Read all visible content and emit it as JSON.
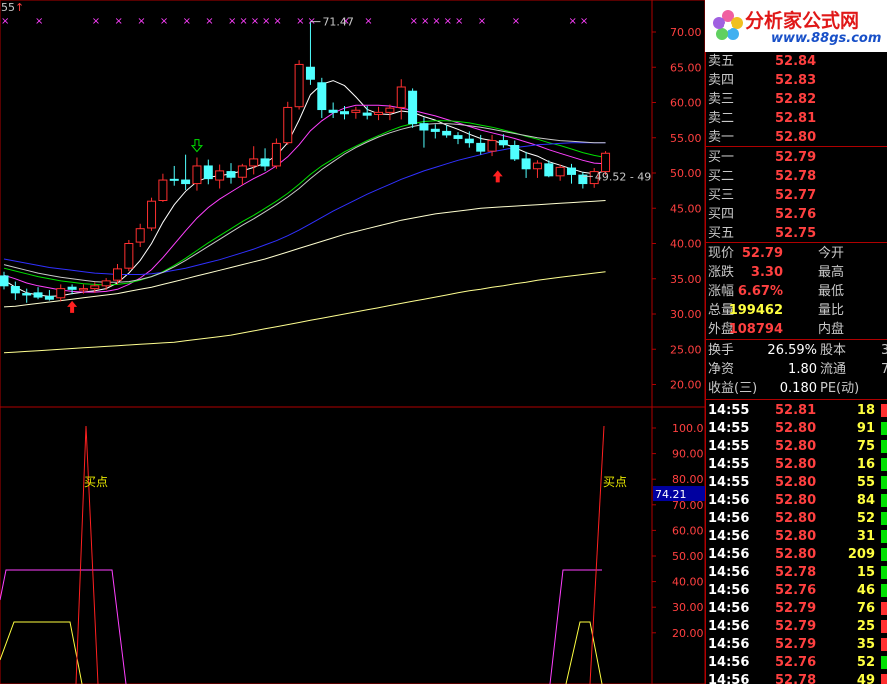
{
  "colors": {
    "background": "#000000",
    "frame": "#b00000",
    "up_candle": "#ff3030",
    "down_candle": "#50ffff",
    "ma_white": "#ffffff",
    "ma_yellow": "#ffff40",
    "ma_magenta": "#ff40ff",
    "ma_green": "#00e000",
    "ma_blue": "#3030ff",
    "ma_light_yellow": "#ffff90",
    "price_red": "#ff4040",
    "volume_yellow": "#ffff40",
    "label_gray": "#c8c8c8"
  },
  "logo": {
    "title": "分析家公式网",
    "url": "www.88gs.com",
    "icon": "flower-logo-icon"
  },
  "top_left_label": "55",
  "main_chart": {
    "y_ticks": [
      "70.00",
      "65.00",
      "60.00",
      "55.00",
      "50.00",
      "45.00",
      "40.00",
      "35.00",
      "30.00",
      "25.00",
      "20.00"
    ],
    "high_label": "71.47",
    "current_label": "49.52 - 49",
    "candles": [
      {
        "o": 35.4,
        "h": 36.0,
        "l": 33.5,
        "c": 34.0
      },
      {
        "o": 33.9,
        "h": 34.6,
        "l": 32.0,
        "c": 33.0
      },
      {
        "o": 32.9,
        "h": 33.6,
        "l": 31.6,
        "c": 32.7
      },
      {
        "o": 33.0,
        "h": 33.8,
        "l": 32.1,
        "c": 32.4
      },
      {
        "o": 32.5,
        "h": 33.4,
        "l": 31.9,
        "c": 32.1
      },
      {
        "o": 32.3,
        "h": 34.2,
        "l": 31.8,
        "c": 33.6
      },
      {
        "o": 33.8,
        "h": 34.2,
        "l": 32.8,
        "c": 33.5
      },
      {
        "o": 33.4,
        "h": 34.2,
        "l": 32.9,
        "c": 33.6
      },
      {
        "o": 33.6,
        "h": 34.5,
        "l": 33.0,
        "c": 34.0
      },
      {
        "o": 34.0,
        "h": 35.1,
        "l": 33.4,
        "c": 34.7
      },
      {
        "o": 34.8,
        "h": 37.1,
        "l": 34.2,
        "c": 36.4
      },
      {
        "o": 36.5,
        "h": 40.5,
        "l": 36.1,
        "c": 40.0
      },
      {
        "o": 40.2,
        "h": 42.8,
        "l": 39.5,
        "c": 42.1
      },
      {
        "o": 42.2,
        "h": 46.5,
        "l": 41.8,
        "c": 46.0
      },
      {
        "o": 46.1,
        "h": 49.9,
        "l": 45.9,
        "c": 49.0
      },
      {
        "o": 49.1,
        "h": 51.0,
        "l": 48.2,
        "c": 49.0
      },
      {
        "o": 49.0,
        "h": 52.6,
        "l": 47.6,
        "c": 48.5
      },
      {
        "o": 48.5,
        "h": 52.2,
        "l": 47.5,
        "c": 51.0
      },
      {
        "o": 51.0,
        "h": 51.9,
        "l": 48.4,
        "c": 49.2
      },
      {
        "o": 49.0,
        "h": 51.2,
        "l": 47.8,
        "c": 50.3
      },
      {
        "o": 50.2,
        "h": 51.4,
        "l": 48.5,
        "c": 49.4
      },
      {
        "o": 49.4,
        "h": 51.3,
        "l": 48.3,
        "c": 51.0
      },
      {
        "o": 51.0,
        "h": 53.8,
        "l": 49.8,
        "c": 52.0
      },
      {
        "o": 52.0,
        "h": 53.5,
        "l": 50.3,
        "c": 51.0
      },
      {
        "o": 51.0,
        "h": 54.9,
        "l": 50.6,
        "c": 54.2
      },
      {
        "o": 54.3,
        "h": 60.1,
        "l": 54.0,
        "c": 59.3
      },
      {
        "o": 59.4,
        "h": 66.0,
        "l": 59.0,
        "c": 65.4
      },
      {
        "o": 65.0,
        "h": 71.5,
        "l": 62.5,
        "c": 63.3
      },
      {
        "o": 62.8,
        "h": 63.5,
        "l": 57.8,
        "c": 59.0
      },
      {
        "o": 58.9,
        "h": 60.0,
        "l": 57.8,
        "c": 58.6
      },
      {
        "o": 58.7,
        "h": 59.5,
        "l": 57.6,
        "c": 58.4
      },
      {
        "o": 58.6,
        "h": 59.4,
        "l": 57.7,
        "c": 58.9
      },
      {
        "o": 58.5,
        "h": 59.5,
        "l": 57.6,
        "c": 58.2
      },
      {
        "o": 58.3,
        "h": 59.4,
        "l": 57.5,
        "c": 58.6
      },
      {
        "o": 58.6,
        "h": 59.7,
        "l": 57.5,
        "c": 59.2
      },
      {
        "o": 59.3,
        "h": 63.3,
        "l": 57.6,
        "c": 62.2
      },
      {
        "o": 61.6,
        "h": 62.0,
        "l": 56.4,
        "c": 57.0
      },
      {
        "o": 57.0,
        "h": 57.9,
        "l": 53.6,
        "c": 56.1
      },
      {
        "o": 56.2,
        "h": 56.9,
        "l": 54.9,
        "c": 55.9
      },
      {
        "o": 55.9,
        "h": 56.8,
        "l": 55.0,
        "c": 55.4
      },
      {
        "o": 55.3,
        "h": 55.8,
        "l": 54.1,
        "c": 54.9
      },
      {
        "o": 54.8,
        "h": 55.9,
        "l": 53.6,
        "c": 54.3
      },
      {
        "o": 54.2,
        "h": 55.4,
        "l": 52.6,
        "c": 53.1
      },
      {
        "o": 53.1,
        "h": 55.4,
        "l": 52.4,
        "c": 54.6
      },
      {
        "o": 54.6,
        "h": 55.5,
        "l": 53.6,
        "c": 54.0
      },
      {
        "o": 53.9,
        "h": 54.6,
        "l": 51.7,
        "c": 52.0
      },
      {
        "o": 52.0,
        "h": 53.0,
        "l": 49.3,
        "c": 50.6
      },
      {
        "o": 50.6,
        "h": 51.8,
        "l": 49.3,
        "c": 51.4
      },
      {
        "o": 51.3,
        "h": 51.8,
        "l": 49.4,
        "c": 49.6
      },
      {
        "o": 49.6,
        "h": 51.2,
        "l": 48.9,
        "c": 50.8
      },
      {
        "o": 50.7,
        "h": 51.3,
        "l": 48.5,
        "c": 49.8
      },
      {
        "o": 49.7,
        "h": 50.1,
        "l": 47.8,
        "c": 48.5
      },
      {
        "o": 48.5,
        "h": 50.7,
        "l": 47.9,
        "c": 50.2
      },
      {
        "o": 50.2,
        "h": 53.1,
        "l": 49.7,
        "c": 52.8
      }
    ],
    "ma_lines": [
      {
        "color": "#ffffff",
        "values": [
          34.8,
          33.8,
          33.0,
          32.7,
          32.5,
          32.6,
          32.9,
          33.1,
          33.3,
          33.6,
          34.4,
          35.8,
          37.6,
          40.0,
          43.0,
          45.5,
          47.4,
          48.8,
          49.4,
          49.6,
          49.9,
          50.3,
          50.8,
          51.4,
          52.5,
          54.3,
          57.5,
          61.1,
          62.6,
          63.1,
          62.4,
          60.8,
          59.0,
          58.4,
          58.3,
          58.8,
          58.6,
          58.0,
          57.5,
          56.8,
          56.2,
          55.5,
          54.9,
          54.6,
          54.2,
          53.6,
          52.9,
          52.4,
          51.6,
          51.1,
          50.6,
          50.1,
          49.9,
          50.3
        ]
      },
      {
        "color": "#ff40ff",
        "values": [
          35.5,
          35.0,
          34.4,
          34.0,
          33.7,
          33.4,
          33.2,
          33.1,
          33.1,
          33.2,
          33.5,
          34.2,
          35.1,
          36.3,
          38.0,
          39.9,
          41.8,
          43.6,
          45.1,
          46.3,
          47.3,
          48.3,
          49.2,
          50.0,
          51.0,
          52.3,
          54.0,
          56.0,
          57.4,
          58.5,
          59.2,
          59.6,
          59.6,
          59.6,
          59.5,
          59.2,
          58.9,
          58.5,
          58.1,
          57.6,
          57.1,
          56.6,
          56.1,
          55.7,
          55.3,
          54.9,
          54.4,
          53.9,
          53.3,
          52.8,
          52.3,
          51.8,
          51.4,
          51.3
        ]
      },
      {
        "color": "#00e000",
        "values": [
          36.5,
          36.1,
          35.7,
          35.3,
          35.0,
          34.7,
          34.5,
          34.3,
          34.2,
          34.1,
          34.2,
          34.4,
          34.8,
          35.3,
          36.0,
          36.9,
          37.9,
          39.0,
          40.1,
          41.1,
          42.1,
          43.1,
          44.0,
          45.0,
          46.0,
          47.1,
          48.4,
          49.8,
          51.0,
          52.0,
          53.0,
          53.8,
          54.6,
          55.3,
          56.0,
          56.6,
          57.0,
          57.3,
          57.4,
          57.4,
          57.3,
          57.1,
          56.8,
          56.5,
          56.1,
          55.7,
          55.2,
          54.8,
          54.3,
          53.9,
          53.4,
          52.9,
          52.5,
          52.2
        ]
      },
      {
        "color": "#3030ff",
        "values": [
          37.8,
          37.5,
          37.2,
          36.9,
          36.6,
          36.4,
          36.2,
          36.0,
          35.8,
          35.7,
          35.6,
          35.6,
          35.6,
          35.7,
          35.9,
          36.2,
          36.5,
          36.9,
          37.3,
          37.7,
          38.2,
          38.7,
          39.2,
          39.8,
          40.4,
          41.1,
          41.9,
          42.8,
          43.7,
          44.6,
          45.4,
          46.2,
          47.0,
          47.7,
          48.4,
          49.1,
          49.7,
          50.3,
          50.8,
          51.3,
          51.8,
          52.2,
          52.6,
          53.0,
          53.3,
          53.6,
          53.8,
          54.0,
          54.1,
          54.2,
          54.3,
          54.3,
          54.3,
          54.3
        ]
      },
      {
        "color": "#c8c8c8",
        "values": [
          37.0,
          36.6,
          36.2,
          35.8,
          35.5,
          35.2,
          35.0,
          34.8,
          34.6,
          34.5,
          34.5,
          34.6,
          34.9,
          35.3,
          35.9,
          36.7,
          37.6,
          38.6,
          39.6,
          40.6,
          41.6,
          42.6,
          43.5,
          44.5,
          45.5,
          46.6,
          47.8,
          49.2,
          50.5,
          51.6,
          52.7,
          53.6,
          54.4,
          55.1,
          55.7,
          56.2,
          56.6,
          56.9,
          57.0,
          57.0,
          56.9,
          56.7,
          56.5,
          56.2,
          55.9,
          55.6,
          55.3,
          55.0,
          54.8,
          54.6,
          54.5,
          54.4,
          54.3,
          54.3
        ]
      },
      {
        "color": "#ffffd0",
        "values": [
          31.0,
          31.1,
          31.3,
          31.5,
          31.7,
          31.9,
          32.1,
          32.3,
          32.5,
          32.7,
          32.9,
          33.2,
          33.5,
          33.8,
          34.2,
          34.6,
          35.0,
          35.4,
          35.8,
          36.2,
          36.6,
          37.0,
          37.4,
          37.8,
          38.3,
          38.8,
          39.3,
          39.8,
          40.3,
          40.8,
          41.3,
          41.7,
          42.1,
          42.5,
          42.9,
          43.3,
          43.6,
          43.9,
          44.2,
          44.4,
          44.6,
          44.8,
          45.0,
          45.1,
          45.2,
          45.3,
          45.4,
          45.5,
          45.6,
          45.7,
          45.8,
          45.9,
          46.0,
          46.1
        ]
      },
      {
        "color": "#ffff90",
        "values": [
          24.5,
          24.6,
          24.7,
          24.8,
          24.9,
          25.0,
          25.1,
          25.2,
          25.3,
          25.4,
          25.5,
          25.6,
          25.7,
          25.8,
          25.9,
          26.0,
          26.2,
          26.4,
          26.6,
          26.8,
          27.0,
          27.3,
          27.6,
          27.9,
          28.2,
          28.5,
          28.8,
          29.1,
          29.4,
          29.7,
          30.0,
          30.3,
          30.6,
          30.9,
          31.2,
          31.5,
          31.8,
          32.1,
          32.4,
          32.7,
          33.0,
          33.3,
          33.5,
          33.8,
          34.0,
          34.3,
          34.5,
          34.8,
          35.0,
          35.2,
          35.4,
          35.6,
          35.8,
          36.0
        ]
      }
    ],
    "marker_positions": [
      0,
      3,
      8,
      10,
      12,
      14,
      16,
      18,
      20,
      21,
      22,
      23,
      24,
      26,
      27,
      30,
      32,
      36,
      37,
      38,
      39,
      40,
      42,
      45,
      50,
      51
    ]
  },
  "indicator": {
    "y_ticks": [
      "100.0",
      "90.00",
      "80.00",
      "70.00",
      "60.00",
      "50.00",
      "40.00",
      "30.00",
      "20.00"
    ],
    "current_value": "74.21",
    "buy_label": "买点",
    "buy_label_2": "买点"
  },
  "quote": {
    "asks": [
      {
        "label": "卖五",
        "price": "52.84"
      },
      {
        "label": "卖四",
        "price": "52.83"
      },
      {
        "label": "卖三",
        "price": "52.82"
      },
      {
        "label": "卖二",
        "price": "52.81"
      },
      {
        "label": "卖一",
        "price": "52.80"
      }
    ],
    "bids": [
      {
        "label": "买一",
        "price": "52.79"
      },
      {
        "label": "买二",
        "price": "52.78"
      },
      {
        "label": "买三",
        "price": "52.77"
      },
      {
        "label": "买四",
        "price": "52.76"
      },
      {
        "label": "买五",
        "price": "52.75"
      }
    ],
    "stats": [
      {
        "label": "现价",
        "value": "52.79",
        "label2": "今开",
        "value2": ""
      },
      {
        "label": "涨跌",
        "value": "3.30",
        "label2": "最高",
        "value2": ""
      },
      {
        "label": "涨幅",
        "value": "6.67%",
        "label2": "最低",
        "value2": ""
      },
      {
        "label": "总量",
        "value": "199462",
        "label2": "量比",
        "value2": ""
      },
      {
        "label": "外盘",
        "value": "108794",
        "label2": "内盘",
        "value2": ""
      }
    ],
    "stats2": [
      {
        "label": "换手",
        "value": "26.59%",
        "label2": "股本",
        "value2": "3"
      },
      {
        "label": "净资",
        "value": "1.80",
        "label2": "流通",
        "value2": "7"
      },
      {
        "label": "收益(三)",
        "value": "0.180",
        "label2": "PE(动)",
        "value2": ""
      }
    ],
    "ticks": [
      {
        "time": "14:55",
        "price": "52.81",
        "vol": "18",
        "dir": "up"
      },
      {
        "time": "14:55",
        "price": "52.80",
        "vol": "91",
        "dir": "down"
      },
      {
        "time": "14:55",
        "price": "52.80",
        "vol": "75",
        "dir": "down"
      },
      {
        "time": "14:55",
        "price": "52.80",
        "vol": "16",
        "dir": "down"
      },
      {
        "time": "14:55",
        "price": "52.80",
        "vol": "55",
        "dir": "down"
      },
      {
        "time": "14:56",
        "price": "52.80",
        "vol": "84",
        "dir": "down"
      },
      {
        "time": "14:56",
        "price": "52.80",
        "vol": "52",
        "dir": "down"
      },
      {
        "time": "14:56",
        "price": "52.80",
        "vol": "31",
        "dir": "down"
      },
      {
        "time": "14:56",
        "price": "52.80",
        "vol": "209",
        "dir": "down"
      },
      {
        "time": "14:56",
        "price": "52.78",
        "vol": "15",
        "dir": "down"
      },
      {
        "time": "14:56",
        "price": "52.76",
        "vol": "46",
        "dir": "down"
      },
      {
        "time": "14:56",
        "price": "52.79",
        "vol": "76",
        "dir": "up"
      },
      {
        "time": "14:56",
        "price": "52.79",
        "vol": "25",
        "dir": "up"
      },
      {
        "time": "14:56",
        "price": "52.79",
        "vol": "35",
        "dir": "up"
      },
      {
        "time": "14:56",
        "price": "52.76",
        "vol": "52",
        "dir": "down"
      },
      {
        "time": "14:56",
        "price": "52.78",
        "vol": "49",
        "dir": "up"
      }
    ]
  }
}
